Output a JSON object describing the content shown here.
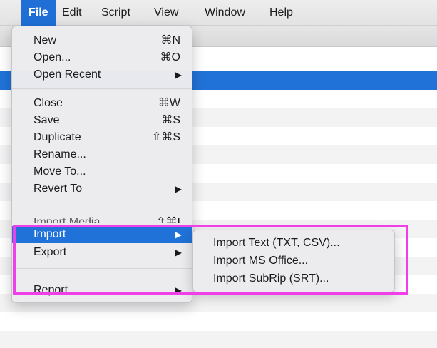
{
  "menubar": {
    "items": [
      "File",
      "Edit",
      "Script",
      "View",
      "Window",
      "Help"
    ],
    "active": "File"
  },
  "file_menu": {
    "new": {
      "label": "New",
      "shortcut": "⌘N"
    },
    "open": {
      "label": "Open...",
      "shortcut": "⌘O"
    },
    "open_recent": {
      "label": "Open Recent",
      "arrow": "▶"
    },
    "close": {
      "label": "Close",
      "shortcut": "⌘W"
    },
    "save": {
      "label": "Save",
      "shortcut": "⌘S"
    },
    "duplicate": {
      "label": "Duplicate",
      "shortcut": "⇧⌘S"
    },
    "rename": {
      "label": "Rename..."
    },
    "move_to": {
      "label": "Move To..."
    },
    "revert_to": {
      "label": "Revert To",
      "arrow": "▶"
    },
    "import_media": {
      "label": "Import Media...",
      "shortcut": "⇧⌘I"
    },
    "import": {
      "label": "Import",
      "arrow": "▶"
    },
    "export": {
      "label": "Export",
      "arrow": "▶"
    },
    "report": {
      "label": "Report",
      "arrow": "▶"
    }
  },
  "import_submenu": {
    "items": [
      "Import Text (TXT, CSV)...",
      "Import MS Office...",
      "Import SubRip (SRT)..."
    ]
  },
  "colors": {
    "accent": "#2172d8",
    "highlight_box": "#ee3fe8"
  }
}
